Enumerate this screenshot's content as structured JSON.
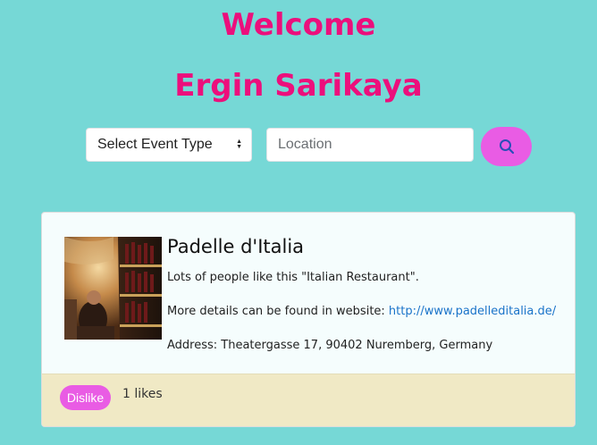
{
  "header": {
    "welcome": "Welcome",
    "user_name": "Ergin Sarikaya"
  },
  "search": {
    "event_type_selected": "Select Event Type",
    "location_placeholder": "Location",
    "location_value": "",
    "search_icon": "search-icon"
  },
  "card": {
    "title": "Padelle d'Italia",
    "description": "Lots of people like this \"Italian Restaurant\".",
    "details_prefix": "More details can be found in website: ",
    "website": "http://www.padelleditalia.de/",
    "address": "Address: Theatergasse 17, 90402 Nuremberg, Germany",
    "image": "restaurant-photo",
    "footer": {
      "dislike_label": "Dislike",
      "likes_text": "1 likes"
    }
  },
  "colors": {
    "background": "#76d8d6",
    "heading": "#ec0f7c",
    "accent_button": "#e95ce4",
    "link": "#1a73c9",
    "footer": "#f0e9c5"
  }
}
